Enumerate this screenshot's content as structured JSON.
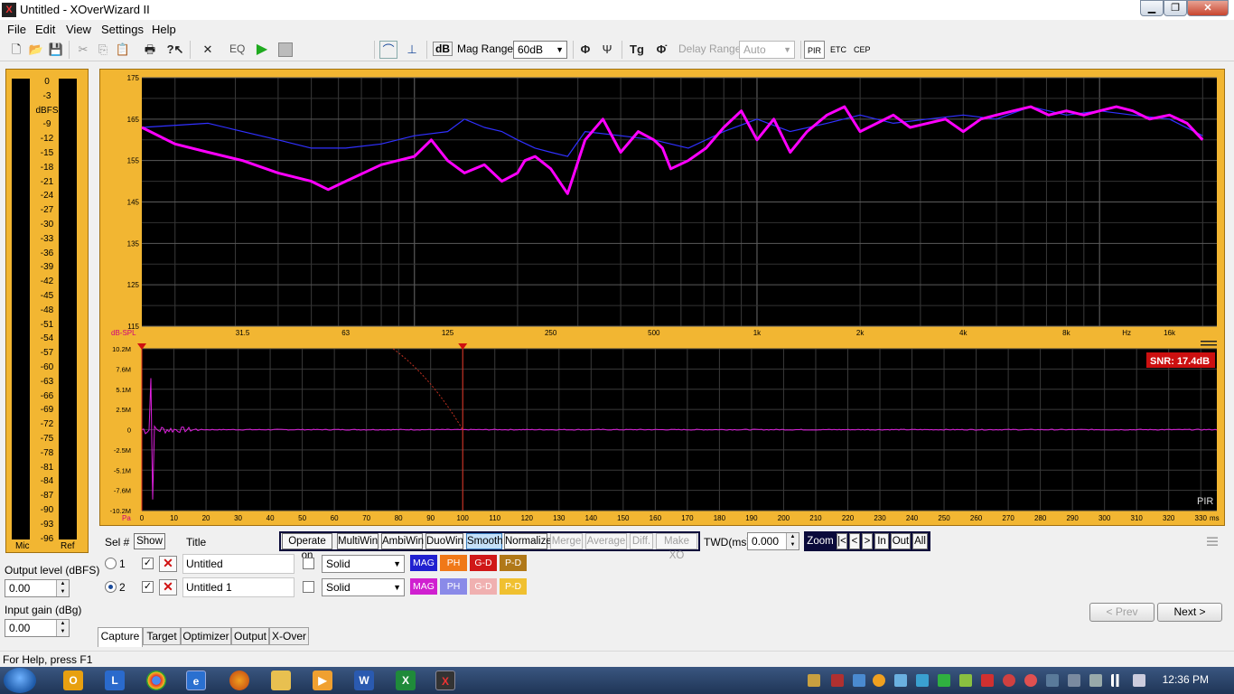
{
  "window": {
    "title": "Untitled - XOverWizard II",
    "app_icon": "X"
  },
  "menu": [
    "File",
    "Edit",
    "View",
    "Settings",
    "Help"
  ],
  "toolbar": {
    "eq_label": "EQ",
    "db_label": "dB",
    "mag_range_label": "Mag Range",
    "mag_range_value": "60dB",
    "delay_range_label": "Delay Range",
    "delay_range_value": "Auto",
    "pir_label": "PIR",
    "etc_label": "ETC",
    "cep_label": "CEP"
  },
  "vu": {
    "scale": [
      "0",
      "-3",
      "dBFS",
      "-9",
      "-12",
      "-15",
      "-18",
      "-21",
      "-24",
      "-27",
      "-30",
      "-33",
      "-36",
      "-39",
      "-42",
      "-45",
      "-48",
      "-51",
      "-54",
      "-57",
      "-60",
      "-63",
      "-66",
      "-69",
      "-72",
      "-75",
      "-78",
      "-81",
      "-84",
      "-87",
      "-90",
      "-93",
      "-96"
    ],
    "left_label": "Mic",
    "right_label": "Ref"
  },
  "left_panel": {
    "output_level_label": "Output level (dBFS)",
    "output_level_value": "0.00",
    "input_gain_label": "Input gain (dBg)",
    "input_gain_value": "0.00"
  },
  "chart_data": [
    {
      "type": "line",
      "ylabel": "dB-SPL",
      "xlabel": "Hz",
      "x_scale": "log",
      "xlim": [
        16,
        22000
      ],
      "ylim": [
        115,
        175
      ],
      "yticks": [
        175,
        165,
        155,
        145,
        135,
        125,
        115
      ],
      "xticks": [
        "31.5",
        "63",
        "125",
        "250",
        "500",
        "1k",
        "2k",
        "4k",
        "8k",
        "Hz",
        "16k"
      ],
      "grid": true,
      "series": [
        {
          "color": "#ff00ff",
          "x": [
            16,
            20,
            25,
            31.5,
            40,
            50,
            56,
            63,
            80,
            100,
            112,
            125,
            140,
            160,
            180,
            200,
            210,
            225,
            250,
            280,
            315,
            355,
            400,
            450,
            500,
            530,
            560,
            630,
            710,
            800,
            900,
            1000,
            1120,
            1250,
            1400,
            1600,
            1800,
            2000,
            2240,
            2500,
            2800,
            3150,
            3550,
            4000,
            4500,
            5000,
            5600,
            6300,
            7100,
            8000,
            9000,
            10000,
            11200,
            12500,
            14000,
            16000,
            18000,
            20000
          ],
          "y": [
            163,
            159,
            157,
            155,
            152,
            150,
            148,
            150,
            154,
            156,
            160,
            155,
            152,
            154,
            150,
            152,
            155,
            156,
            153,
            147,
            160,
            165,
            157,
            162,
            160,
            158,
            153,
            155,
            158,
            163,
            167,
            160,
            165,
            157,
            162,
            166,
            168,
            162,
            164,
            166,
            163,
            164,
            165,
            162,
            165,
            166,
            167,
            168,
            166,
            167,
            166,
            167,
            168,
            167,
            165,
            166,
            164,
            160
          ]
        },
        {
          "color": "#3030ff",
          "x": [
            16,
            25,
            31.5,
            40,
            50,
            63,
            80,
            100,
            125,
            140,
            160,
            180,
            200,
            225,
            250,
            280,
            315,
            400,
            500,
            630,
            800,
            1000,
            1250,
            1600,
            2000,
            2500,
            3150,
            4000,
            5000,
            6300,
            8000,
            10000,
            12500,
            16000,
            20000
          ],
          "y": [
            163,
            164,
            162,
            160,
            158,
            158,
            159,
            161,
            162,
            165,
            163,
            162,
            160,
            158,
            157,
            156,
            162,
            161,
            160,
            158,
            162,
            165,
            162,
            164,
            166,
            164,
            165,
            166,
            165,
            168,
            166,
            167,
            166,
            165,
            161
          ]
        }
      ]
    },
    {
      "type": "line",
      "xlabel": "ms",
      "ylabel": "Pa",
      "xlim": [
        0,
        335
      ],
      "ylim": [
        -10.2,
        10.2
      ],
      "yticks": [
        "10.2M",
        "7.6M",
        "5.1M",
        "2.5M",
        "0",
        "-2.5M",
        "-5.1M",
        "-7.6M",
        "-10.2M"
      ],
      "xticks": [
        0,
        10,
        20,
        30,
        40,
        50,
        60,
        70,
        80,
        90,
        100,
        110,
        120,
        130,
        140,
        150,
        160,
        170,
        180,
        190,
        200,
        210,
        220,
        230,
        240,
        250,
        260,
        270,
        280,
        290,
        300,
        310,
        320,
        330
      ],
      "markers_ms": [
        0,
        100
      ],
      "snr_label": "SNR: 17.4dB",
      "mode_label": "PIR"
    }
  ],
  "controls": {
    "sel_label": "Sel #",
    "show_label": "Show",
    "title_label": "Title",
    "operate_on": "Operate on",
    "buttons": [
      "MultiWin",
      "AmbiWin",
      "DuoWin",
      "Smooth",
      "Normalize",
      "Merge",
      "Average",
      "Diff.",
      "Make XO"
    ],
    "twd_label": "TWD(ms)",
    "twd_value": "0.000",
    "zoom_label": "Zoom",
    "zoom_buttons": [
      "|<",
      "<",
      ">",
      "In",
      "Out",
      "All"
    ]
  },
  "traces": [
    {
      "num": "1",
      "title": "Untitled",
      "style": "Solid",
      "selected": false
    },
    {
      "num": "2",
      "title": "Untitled 1",
      "style": "Solid",
      "selected": true
    }
  ],
  "trace_buttons": [
    "MAG",
    "PH",
    "G-D",
    "P-D"
  ],
  "nav": {
    "prev": "< Prev",
    "next": "Next >"
  },
  "tabs": [
    "Capture",
    "Target",
    "Optimizer",
    "Output",
    "X-Over"
  ],
  "status": "For Help, press F1",
  "clock": "12:36 PM"
}
